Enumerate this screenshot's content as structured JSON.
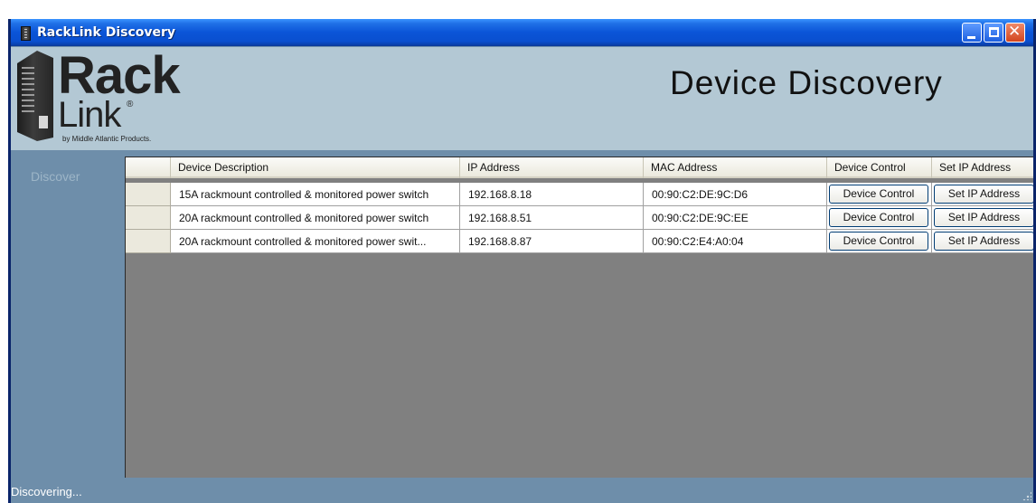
{
  "window": {
    "title": "RackLink Discovery"
  },
  "logo": {
    "word1": "Rack",
    "word2": "Link",
    "registered": "®",
    "byline": "by Middle Atlantic Products."
  },
  "header": {
    "title": "Device Discovery"
  },
  "sidebar": {
    "items": [
      {
        "label": "Discover"
      }
    ]
  },
  "grid": {
    "columns": [
      "Device Description",
      "IP Address",
      "MAC Address",
      "Device Control",
      "Set IP Address"
    ],
    "rows": [
      {
        "description": "15A rackmount controlled & monitored power switch",
        "ip": "192.168.8.18",
        "mac": "00:90:C2:DE:9C:D6",
        "control_label": "Device Control",
        "setip_label": "Set IP Address"
      },
      {
        "description": "20A rackmount controlled & monitored power switch",
        "ip": "192.168.8.51",
        "mac": "00:90:C2:DE:9C:EE",
        "control_label": "Device Control",
        "setip_label": "Set IP Address"
      },
      {
        "description": "20A rackmount controlled & monitored power swit...",
        "ip": "192.168.8.87",
        "mac": "00:90:C2:E4:A0:04",
        "control_label": "Device Control",
        "setip_label": "Set IP Address"
      }
    ]
  },
  "statusbar": {
    "text": "Discovering..."
  },
  "icons": {
    "app": "rack-icon",
    "minimize": "minimize-icon",
    "maximize": "maximize-icon",
    "close": "close-icon",
    "grip": "resize-grip-icon"
  },
  "colors": {
    "titlebar": "#0b55d8",
    "header_bg": "#b3c8d4",
    "sidebar_bg": "#6e8eaa",
    "grid_bg": "#808080"
  }
}
